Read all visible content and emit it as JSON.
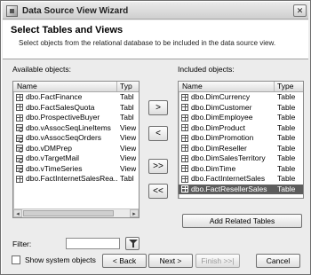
{
  "window": {
    "title": "Data Source View Wizard"
  },
  "header": {
    "title": "Select Tables and Views",
    "description": "Select objects from the relational database to be included in the data source view."
  },
  "available": {
    "label": "Available objects:",
    "columns": {
      "name": "Name",
      "type": "Typ"
    },
    "rows": [
      {
        "name": "dbo.FactFinance",
        "type": "Tabl",
        "icon": "table-icon"
      },
      {
        "name": "dbo.FactSalesQuota",
        "type": "Tabl",
        "icon": "table-icon"
      },
      {
        "name": "dbo.ProspectiveBuyer",
        "type": "Tabl",
        "icon": "table-icon"
      },
      {
        "name": "dbo.vAssocSeqLineItems",
        "type": "View",
        "icon": "view-icon"
      },
      {
        "name": "dbo.vAssocSeqOrders",
        "type": "View",
        "icon": "view-icon"
      },
      {
        "name": "dbo.vDMPrep",
        "type": "View",
        "icon": "view-icon"
      },
      {
        "name": "dbo.vTargetMail",
        "type": "View",
        "icon": "view-icon"
      },
      {
        "name": "dbo.vTimeSeries",
        "type": "View",
        "icon": "view-icon"
      },
      {
        "name": "dbo.FactInternetSalesRea...",
        "type": "Tabl",
        "icon": "table-icon"
      }
    ]
  },
  "included": {
    "label": "Included objects:",
    "columns": {
      "name": "Name",
      "type": "Type"
    },
    "rows": [
      {
        "name": "dbo.DimCurrency",
        "type": "Table",
        "icon": "table-icon",
        "selected": false
      },
      {
        "name": "dbo.DimCustomer",
        "type": "Table",
        "icon": "table-icon",
        "selected": false
      },
      {
        "name": "dbo.DimEmployee",
        "type": "Table",
        "icon": "table-icon",
        "selected": false
      },
      {
        "name": "dbo.DimProduct",
        "type": "Table",
        "icon": "table-icon",
        "selected": false
      },
      {
        "name": "dbo.DimPromotion",
        "type": "Table",
        "icon": "table-icon",
        "selected": false
      },
      {
        "name": "dbo.DimReseller",
        "type": "Table",
        "icon": "table-icon",
        "selected": false
      },
      {
        "name": "dbo.DimSalesTerritory",
        "type": "Table",
        "icon": "table-icon",
        "selected": false
      },
      {
        "name": "dbo.DimTime",
        "type": "Table",
        "icon": "table-icon",
        "selected": false
      },
      {
        "name": "dbo.FactInternetSales",
        "type": "Table",
        "icon": "table-icon",
        "selected": false
      },
      {
        "name": "dbo.FactResellerSales",
        "type": "Table",
        "icon": "table-icon",
        "selected": true
      }
    ],
    "selected_row_color": "#5d5d5d"
  },
  "move_buttons": {
    "add": ">",
    "remove": "<",
    "add_all": ">>",
    "remove_all": "<<"
  },
  "add_related_label": "Add Related Tables",
  "filter": {
    "label": "Filter:",
    "value": "",
    "button_icon": "funnel-icon"
  },
  "show_system": {
    "label": "Show system objects",
    "checked": false
  },
  "footer": {
    "back": "< Back",
    "next": "Next >",
    "finish": "Finish >>|",
    "cancel": "Cancel"
  }
}
